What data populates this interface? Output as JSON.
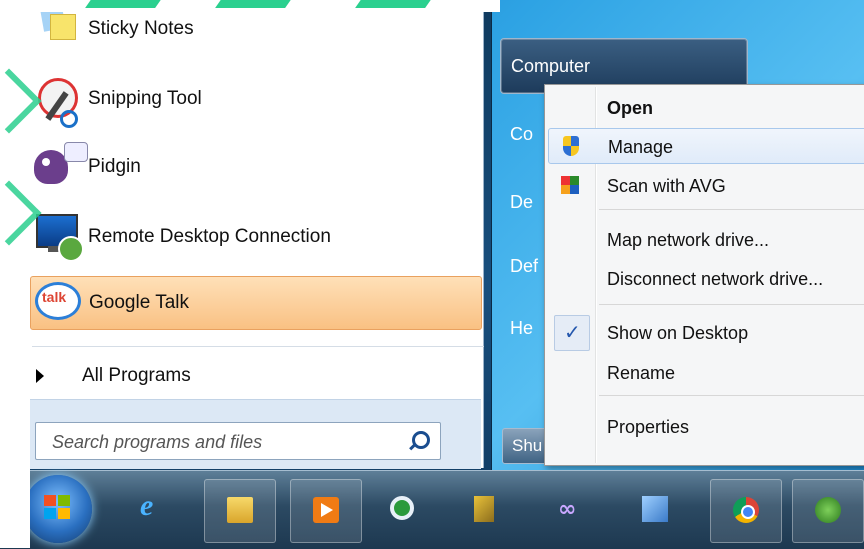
{
  "start_menu": {
    "programs": [
      {
        "label": "Sticky Notes",
        "icon": "sticky-notes-icon"
      },
      {
        "label": "Snipping Tool",
        "icon": "snipping-tool-icon"
      },
      {
        "label": "Pidgin",
        "icon": "pidgin-icon"
      },
      {
        "label": "Remote Desktop Connection",
        "icon": "remote-desktop-icon"
      },
      {
        "label": "Google Talk",
        "icon": "google-talk-icon"
      }
    ],
    "all_programs_label": "All Programs",
    "search_placeholder": "Search programs and files",
    "right_pane": {
      "computer_label": "Computer",
      "partial_items": [
        "Co",
        "De",
        "Def",
        "He"
      ],
      "shutdown_partial": "Shu"
    }
  },
  "context_menu": {
    "items": [
      {
        "label": "Open",
        "bold": true
      },
      {
        "label": "Manage",
        "icon": "uac-shield-icon"
      },
      {
        "label": "Scan with AVG",
        "icon": "avg-icon"
      },
      {
        "label": "Map network drive..."
      },
      {
        "label": "Disconnect network drive..."
      },
      {
        "label": "Show on Desktop",
        "checked": true
      },
      {
        "label": "Rename"
      },
      {
        "label": "Properties"
      }
    ]
  },
  "taskbar": {
    "items": [
      "start-orb",
      "internet-explorer-icon",
      "windows-explorer-icon",
      "media-player-icon",
      "search-app-icon",
      "installer-icon",
      "link-icon",
      "remote-app-icon",
      "chrome-icon",
      "network-app-icon"
    ]
  },
  "colors": {
    "highlight": "#f9c183",
    "taskbar": "#2c4a63",
    "menu_dark": "#184f7e",
    "watermark": "#2bd08f"
  }
}
